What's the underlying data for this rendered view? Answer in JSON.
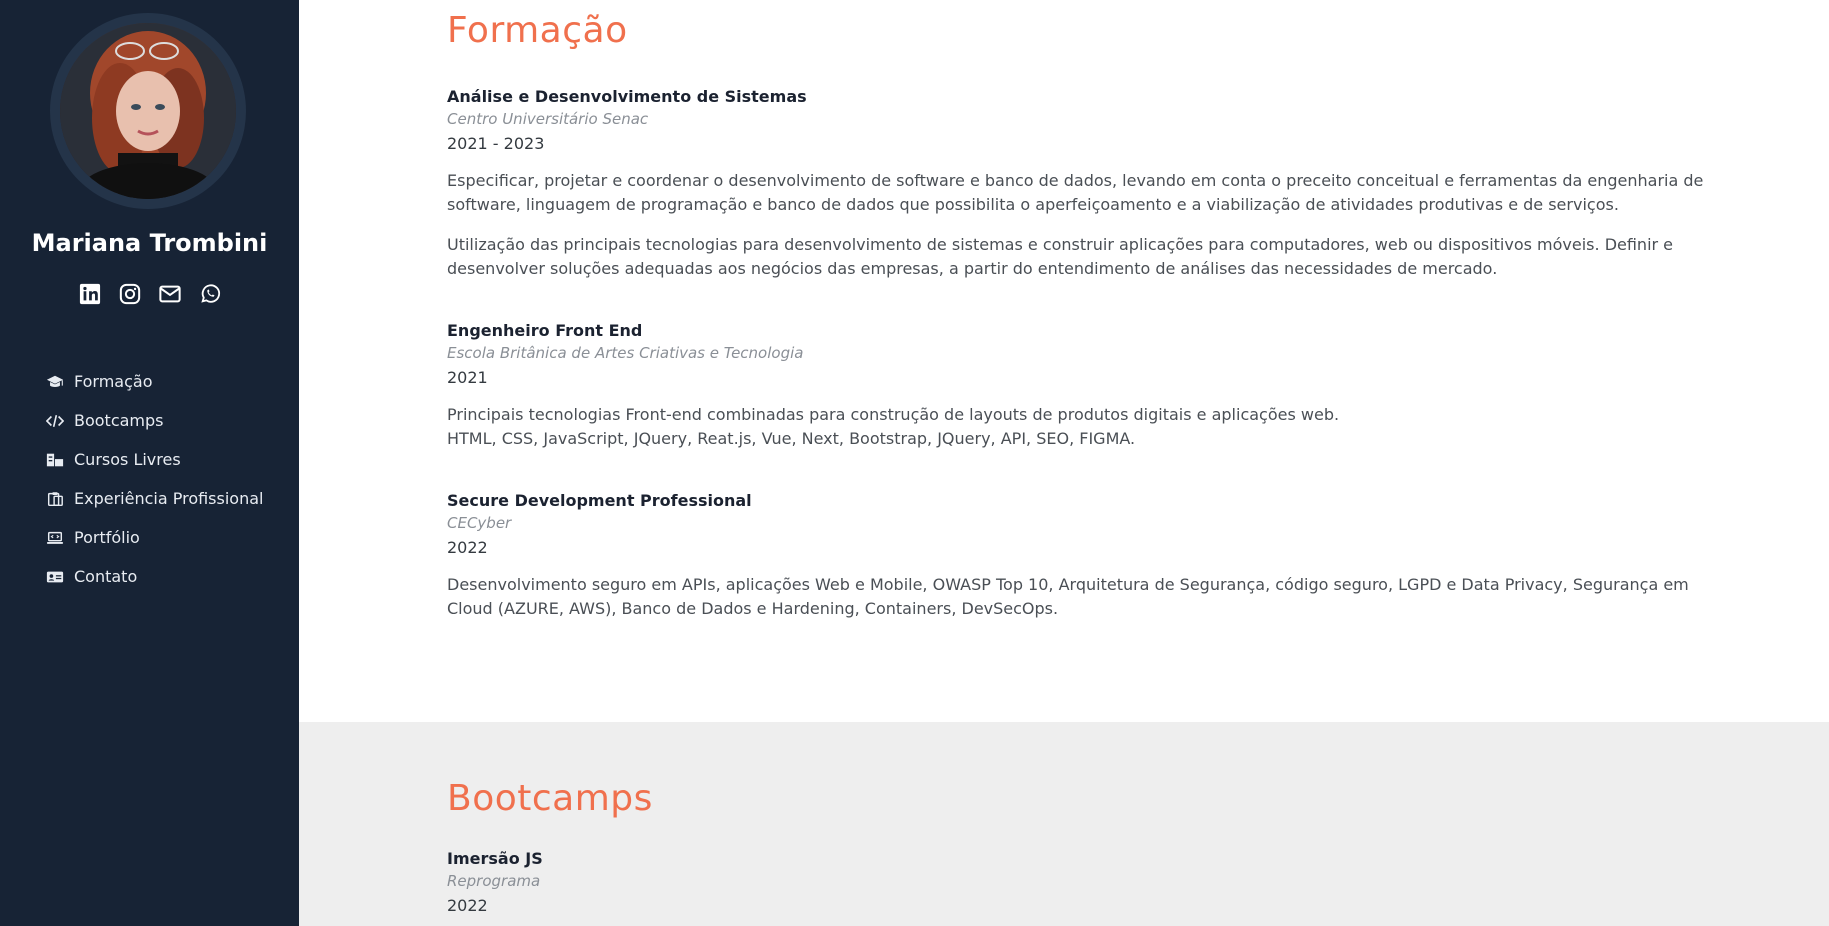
{
  "profile": {
    "name": "Mariana Trombini"
  },
  "socials": [
    {
      "icon": "linkedin-icon"
    },
    {
      "icon": "instagram-icon"
    },
    {
      "icon": "envelope-icon"
    },
    {
      "icon": "whatsapp-icon"
    }
  ],
  "nav": {
    "items": [
      {
        "label": "Formação",
        "icon": "graduation-cap-icon"
      },
      {
        "label": "Bootcamps",
        "icon": "code-icon"
      },
      {
        "label": "Cursos Livres",
        "icon": "courses-icon"
      },
      {
        "label": "Experiência Profissional",
        "icon": "clipboard-icon"
      },
      {
        "label": "Portfólio",
        "icon": "laptop-icon"
      },
      {
        "label": "Contato",
        "icon": "contact-card-icon"
      }
    ]
  },
  "formacao": {
    "title": "Formação",
    "entries": [
      {
        "title": "Análise e Desenvolvimento de Sistemas",
        "org": "Centro Universitário Senac",
        "date": "2021 - 2023",
        "p1": "Especificar, projetar e coordenar o desenvolvimento de software e banco de dados, levando em conta o preceito conceitual e ferramentas da engenharia de software, linguagem de programação e banco de dados que possibilita o aperfeiçoamento e a viabilização de atividades produtivas e de serviços.",
        "p2": "Utilização das principais tecnologias para desenvolvimento de sistemas e construir aplicações para computadores, web ou dispositivos móveis. Definir e desenvolver soluções adequadas aos negócios das empresas, a partir do entendimento de análises das necessidades de mercado."
      },
      {
        "title": "Engenheiro Front End",
        "org": "Escola Britânica de Artes Criativas e Tecnologia",
        "date": "2021",
        "p1": "Principais tecnologias Front-end combinadas para construção de layouts de produtos digitais e aplicações web.",
        "p1b": "HTML, CSS, JavaScript, JQuery, Reat.js, Vue, Next, Bootstrap, JQuery, API, SEO, FIGMA."
      },
      {
        "title": "Secure Development Professional",
        "org": "CECyber",
        "date": "2022",
        "p1": "Desenvolvimento seguro em APIs, aplicações Web e Mobile, OWASP Top 10, Arquitetura de Segurança, código seguro, LGPD e Data Privacy, Segurança em Cloud (AZURE, AWS), Banco de Dados e Hardening, Containers, DevSecOps."
      }
    ]
  },
  "bootcamps": {
    "title": "Bootcamps",
    "entries": [
      {
        "title": "Imersão JS",
        "org": "Reprograma",
        "date": "2022"
      }
    ]
  },
  "colors": {
    "sidebar": "#172335",
    "accent": "#f0704d",
    "gray_section": "#eeeeee"
  }
}
